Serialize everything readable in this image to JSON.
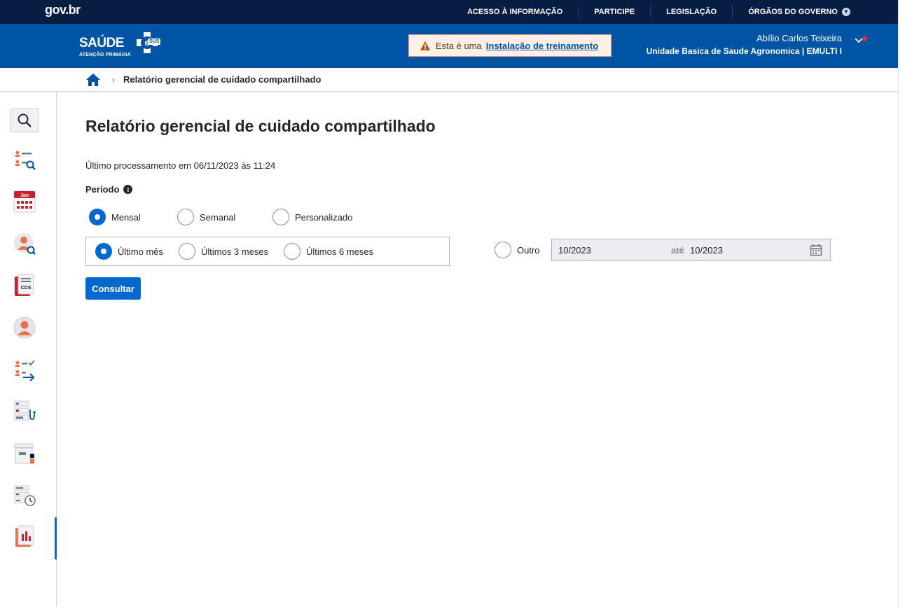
{
  "govbar": {
    "logo": "gov.br",
    "links": [
      "ACESSO À INFORMAÇÃO",
      "PARTICIPE",
      "LEGISLAÇÃO",
      "ÓRGÃOS DO GOVERNO"
    ]
  },
  "header": {
    "brand": "SAÚDE",
    "brand_sub": "ATENÇÃO PRIMÁRIA",
    "brand_badge": "SUS",
    "training_prefix": "Esta é uma",
    "training_link": "Instalação de treinamento",
    "user_name": "Abílio Carlos Teixeira",
    "user_unit": "Unidade Basica de Saude Agronomica | EMULTI I"
  },
  "breadcrumb": {
    "current": "Relatório gerencial de cuidado compartilhado"
  },
  "sidebar": {
    "calendar_label": "Jan",
    "cds_label": "CDS"
  },
  "main": {
    "title": "Relatório gerencial de cuidado compartilhado",
    "processed": "Último processamento em 06/11/2023 às 11:24",
    "period_label": "Período",
    "period_options": [
      "Mensal",
      "Semanal",
      "Personalizado"
    ],
    "range_options": [
      "Último mês",
      "Últimos 3 meses",
      "Últimos 6 meses"
    ],
    "other_label": "Outro",
    "date_from": "10/2023",
    "date_separator": "até",
    "date_to": "10/2023",
    "submit_label": "Consultar"
  },
  "colors": {
    "gov_navy": "#071d41",
    "header_blue": "#0054a6",
    "primary": "#0069d0"
  }
}
